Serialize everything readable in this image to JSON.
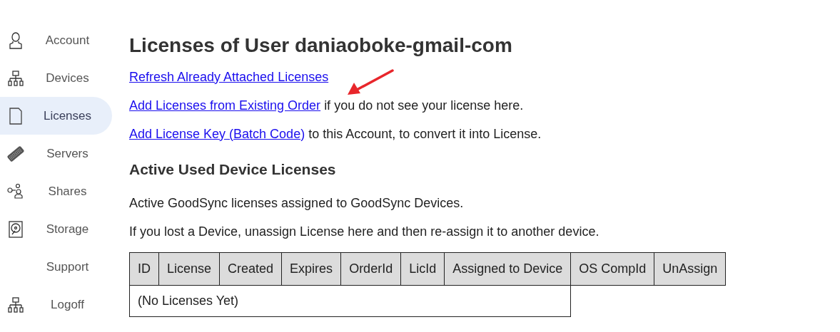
{
  "sidebar": {
    "items": [
      {
        "label": "Account",
        "kind": "person",
        "selected": false
      },
      {
        "label": "Devices",
        "kind": "network",
        "selected": false
      },
      {
        "label": "Licenses",
        "kind": "document",
        "selected": true
      },
      {
        "label": "Servers",
        "kind": "keyboard",
        "selected": false
      },
      {
        "label": "Shares",
        "kind": "share",
        "selected": false
      },
      {
        "label": "Storage",
        "kind": "disk",
        "selected": false
      },
      {
        "label": "Support",
        "kind": "plain",
        "selected": false
      },
      {
        "label": "Logoff",
        "kind": "network",
        "selected": false
      }
    ]
  },
  "title": "Licenses of User daniaoboke-gmail-com",
  "actions": [
    {
      "link": "Refresh Already Attached Licenses"
    },
    {
      "link": "Add Licenses from Existing Order",
      "text": "if you do not see your license here."
    },
    {
      "link": "Add License Key (Batch Code)",
      "text": "to this Account, to convert it into License."
    }
  ],
  "section_title": "Active Used Device Licenses",
  "paragraphs": [
    "Active GoodSync licenses assigned to GoodSync Devices.",
    "If you lost a Device, unassign License here and then re-assign it to another device."
  ],
  "table": {
    "columns": [
      "ID",
      "License",
      "Created",
      "Expires",
      "OrderId",
      "LicId",
      "Assigned to Device",
      "OS CompId",
      "UnAssign"
    ],
    "empty_text": "(No Licenses Yet)"
  }
}
